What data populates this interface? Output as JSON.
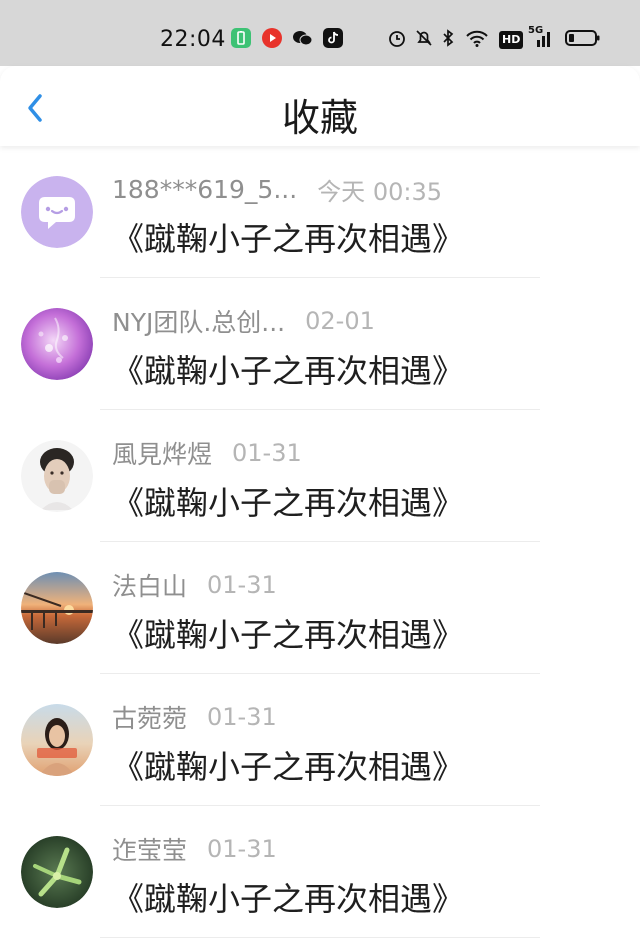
{
  "status_bar": {
    "time": "22:04",
    "app_icons": [
      "battery-saver-icon",
      "video-app-icon",
      "wechat-icon",
      "tiktok-icon"
    ],
    "system_icons": [
      "alarm-icon",
      "mute-icon",
      "bluetooth-icon",
      "wifi-icon",
      "hd-icon",
      "signal-5g-icon",
      "battery-icon"
    ],
    "network": "5G",
    "hd": "HD"
  },
  "header": {
    "back_icon": "chevron-left-icon",
    "title": "收藏",
    "accent": "#2f8fe6"
  },
  "items": [
    {
      "user": "188***619_5...",
      "time": "今天 00:35",
      "title": "《蹴鞠小子之再次相遇》",
      "avatar": "default-chat-avatar"
    },
    {
      "user": "NYJ团队.总创...",
      "time": "02-01",
      "title": "《蹴鞠小子之再次相遇》",
      "avatar": "purple-photo-avatar"
    },
    {
      "user": "風見烨煜",
      "time": "01-31",
      "title": "《蹴鞠小子之再次相遇》",
      "avatar": "portrait-avatar"
    },
    {
      "user": "法白山",
      "time": "01-31",
      "title": "《蹴鞠小子之再次相遇》",
      "avatar": "pier-sunset-avatar"
    },
    {
      "user": "古菀菀",
      "time": "01-31",
      "title": "《蹴鞠小子之再次相遇》",
      "avatar": "girl-photo-avatar"
    },
    {
      "user": "迮莹莹",
      "time": "01-31",
      "title": "《蹴鞠小子之再次相遇》",
      "avatar": "green-plant-avatar"
    }
  ]
}
